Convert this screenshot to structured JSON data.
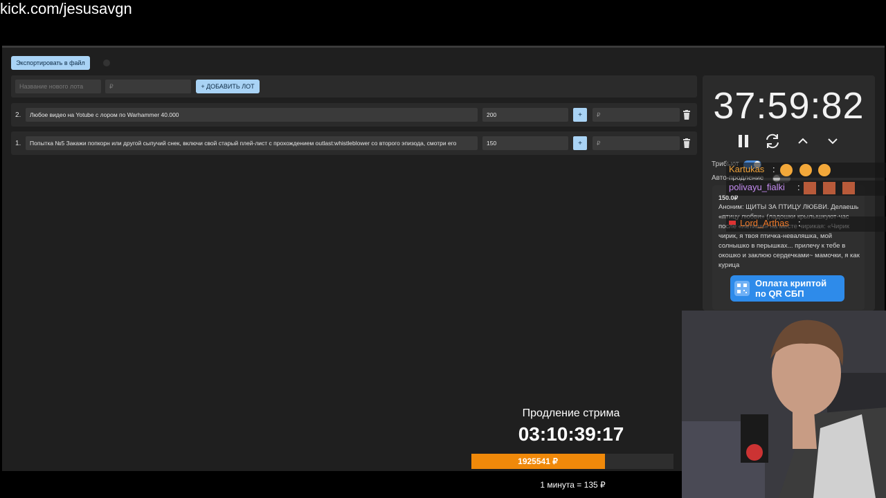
{
  "url": "kick.com/jesusavgn",
  "toolbar": {
    "export_label": "Экспортировать в файл"
  },
  "add_form": {
    "name_placeholder": "Название нового лота",
    "price_placeholder": "₽",
    "add_label": "+ ДОБАВИТЬ ЛОТ"
  },
  "lots": [
    {
      "number": "2.",
      "title": "Любое видео на Yotube с лором по Warhammer 40.000",
      "amount": "200",
      "plus": "+",
      "rub_placeholder": "₽"
    },
    {
      "number": "1.",
      "title": "Попытка №5 Закажи попкорн или другой сыпучий снек, включи свой старый плей-лист с прохождением outlast:whistleblower со второго эпизода, смотри его",
      "amount": "150",
      "plus": "+",
      "rub_placeholder": "₽"
    }
  ],
  "timer": {
    "value": "37:59:82"
  },
  "toggles": {
    "tribute": "Трибьют",
    "autoextend": "Авто-продление"
  },
  "donation": {
    "amount": "150.0₽",
    "text": "Аноним: ЩИТЫ ЗА ПТИЦУ ЛЮБВИ. Делаешь «птицу любви» (ладошки крылышкуют-час после «летишь» на месте чирикая: «Чирик чирик, я твоя птичка-неваляшка, мой солнышко в перышках... прилечу к тебе в окошко и заклюю сердечками~ мамочки, я как курица"
  },
  "chat": [
    {
      "user": "Kartukas",
      "sep": ":",
      "color": "#f0a23a"
    },
    {
      "user": "polivayu_fialki",
      "sep": ":",
      "color": "#c58cf2"
    },
    {
      "user": "Lord_Arthas",
      "sep": ":",
      "color": "#f07a2a"
    }
  ],
  "crypto": {
    "line1": "Оплата криптой",
    "line2": "по QR СБП"
  },
  "extension": {
    "title": "Продление стрима",
    "timer": "03:10:39:17",
    "progress_label": "1925541 ₽",
    "progress_fraction": 0.66,
    "rate": "1 минута = 135 ₽"
  },
  "colors": {
    "accent": "#a9d3f5",
    "progress": "#f0890a",
    "crypto": "#2e8bea"
  }
}
